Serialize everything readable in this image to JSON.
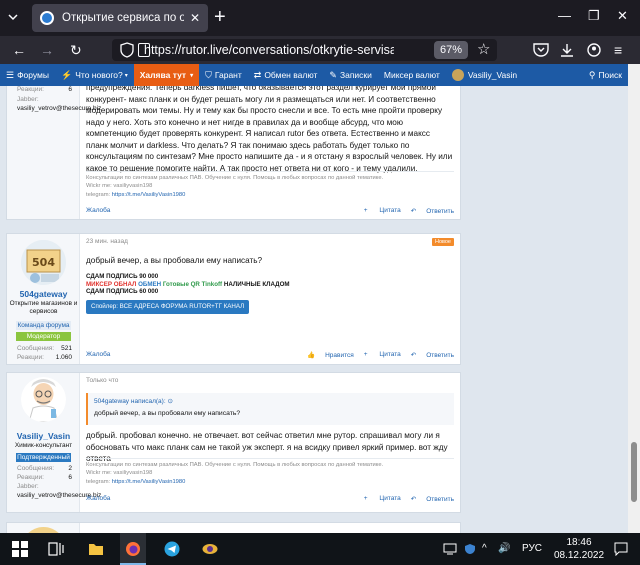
{
  "browser": {
    "tab_title": "Открытие сервиса по обучени",
    "url": "https://rutor.live/conversations/otkrytie-servisa-p",
    "zoom": "67%"
  },
  "sitenav": {
    "items": [
      "Форумы",
      "Что нового?",
      "Халява тут",
      "Гарант",
      "Обмен валют",
      "Записки",
      "Миксер валют",
      "Vasiliy_Vasin",
      "Поиск"
    ]
  },
  "post1": {
    "stats": [
      {
        "label": "Реакции:",
        "value": "6"
      }
    ],
    "jabber_label": "Jabber:",
    "jabber_value": "vasiliy_vetrov@thesecure.biz",
    "text": "предупреждения. Теперь darkless пишет, что оказывается этот раздел курирует мой прямой конкурент- макс планк и он будет решать могу ли я размещаться или нет. И соответственно модерировать мои темы. Ну и тему как бы просто снесли и все. То есть мне пройти проверку надо у него. Хоть это конечно и нет нигде в правилах да и вообще абсурд, что мою компетенцию будет проверять конкурент. Я написал rutor без ответа. Естественно и максс планк молчит и darkless. Что делать? Я так понимаю здесь работать будет только по консультациям по синтезам? Мне просто напишите да - и я отстану я взрослый человек. Ну или какое то решение помогите найти. А так просто нет ответа ни от кого - и тему удалили.",
    "sig_line1": "Консультации по синтезам различных ПАВ. Обучение с нуля. Помощь в любых вопросах по данной тематике.",
    "sig_line2": "Wickr me: vasiliyvasin198",
    "sig_line3_label": "telegram: ",
    "sig_line3_link": "https://t.me/VasiliyVasin1980",
    "report": "Жалоба",
    "quote": "Цитата",
    "reply": "Ответить"
  },
  "post2": {
    "date": "23 мин. назад",
    "new_badge": "Новое",
    "username": "504gateway",
    "title": "Открытие магазинов и сервисов",
    "team_badge": "Команда форума",
    "role_badge": "Модератор",
    "avatar_text": "504",
    "stats": [
      {
        "label": "Сообщения:",
        "value": "521"
      },
      {
        "label": "Реакции:",
        "value": "1.060"
      }
    ],
    "text": "добрый вечер, а вы пробовали ему написать?",
    "promo1": "СДАМ ПОДПИСЬ 90 000",
    "promo2a": "МИКСЕР ОБНАЛ",
    "promo2b": " ОБМЕН ",
    "promo2c": "Готовые QR Tinkoff",
    "promo2d": " НАЛИЧНЫЕ КЛАДОМ",
    "promo3": "СДАМ ПОДПИСЬ 60 000",
    "spoiler": "Спойлер: ВСЕ АДРЕСА ФОРУМА RUTOR+ТГ КАНАЛ",
    "report": "Жалоба",
    "like": "Нравится",
    "quote": "Цитата",
    "reply": "Ответить"
  },
  "post3": {
    "date": "Только что",
    "username": "Vasiliy_Vasin",
    "title": "Химик-консультант",
    "verified_badge": "Подтвержденный",
    "stats": [
      {
        "label": "Сообщения:",
        "value": "2"
      },
      {
        "label": "Реакции:",
        "value": "6"
      }
    ],
    "jabber_label": "Jabber:",
    "jabber_value": "vasiliy_vetrov@thesecure.biz",
    "quote_header": "504gateway написал(а):",
    "quote_body": "добрый вечер, а вы пробовали ему написать?",
    "text": "добрый. пробовал конечно. не отвечает. вот сейчас ответил мне рутор. спрашивал могу ли я обосновать что макс планк сам не такой уж эксперт. я на всидку привел яркий пример. вот жду ответа",
    "sig_line1": "Консультации по синтезам различных ПАВ. Обучение с нуля. Помощь в любых вопросах по данной тематике.",
    "sig_line2": "Wickr me: vasiliyvasin198",
    "sig_line3_label": "telegram: ",
    "sig_line3_link": "https://t.me/VasiliyVasin1980",
    "report": "Жалоба",
    "quote": "Цитата",
    "reply": "Ответить"
  },
  "taskbar": {
    "time": "18:46",
    "date": "08.12.2022",
    "lang": "РУС"
  },
  "colors": {
    "site_nav": "#1d5aa5",
    "hot_item": "#e85d13",
    "link": "#2265b0",
    "moderator": "#8bc53f",
    "verified": "#2a79c1"
  }
}
